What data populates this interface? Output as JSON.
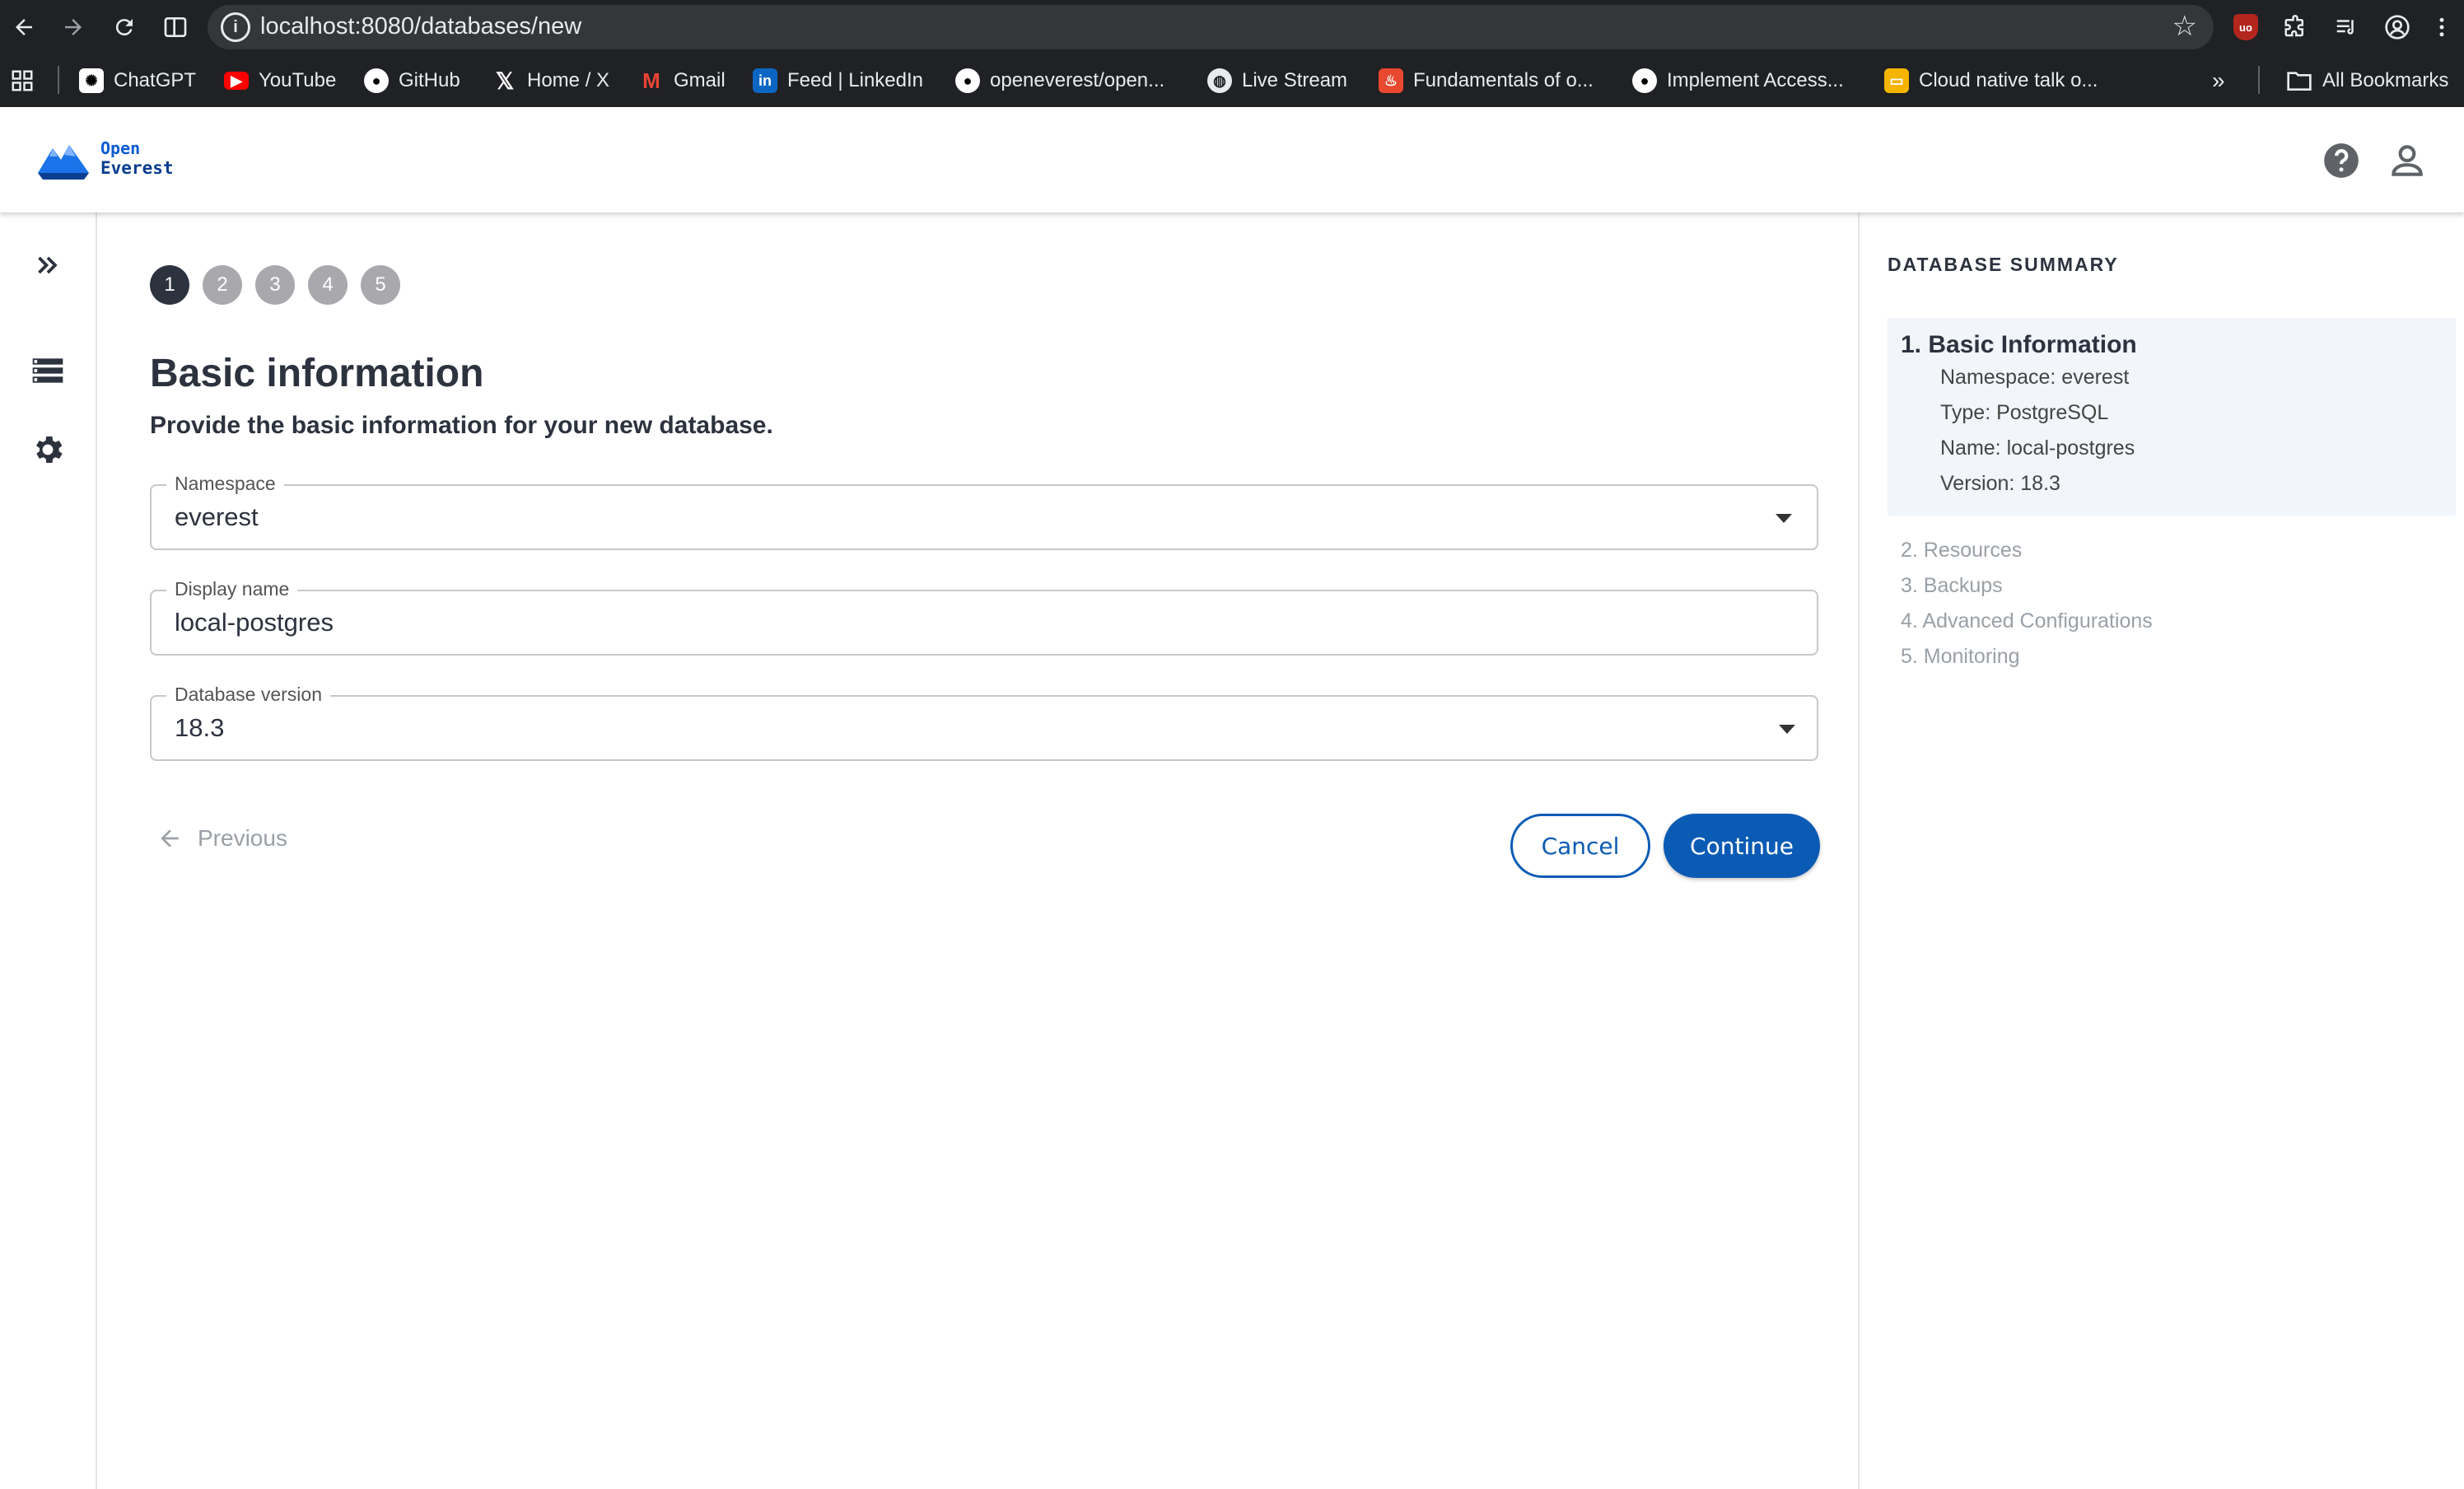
{
  "browser": {
    "url_host": "localhost:8080",
    "url_path": "/databases/new",
    "bookmarks": [
      {
        "label": "ChatGPT",
        "icon": "chatgpt-icon"
      },
      {
        "label": "YouTube",
        "icon": "youtube-icon"
      },
      {
        "label": "GitHub",
        "icon": "github-icon"
      },
      {
        "label": "Home / X",
        "icon": "x-icon"
      },
      {
        "label": "Gmail",
        "icon": "gmail-icon"
      },
      {
        "label": "Feed | LinkedIn",
        "icon": "linkedin-icon"
      },
      {
        "label": "openeverest/open...",
        "icon": "github-icon"
      },
      {
        "label": "Live Stream",
        "icon": "globe-icon"
      },
      {
        "label": "Fundamentals of o...",
        "icon": "flame-icon"
      },
      {
        "label": "Implement Access...",
        "icon": "github-icon"
      },
      {
        "label": "Cloud native talk o...",
        "icon": "slides-icon"
      }
    ],
    "all_bookmarks": "All Bookmarks",
    "ext_badge": "uo"
  },
  "app": {
    "logo_line1": "Open",
    "logo_line2": "Everest",
    "brand_color": "#0b5bb5"
  },
  "wizard": {
    "steps": [
      "1",
      "2",
      "3",
      "4",
      "5"
    ],
    "active_step": 1,
    "title": "Basic information",
    "subtitle": "Provide the basic information for your new database.",
    "fields": {
      "namespace": {
        "label": "Namespace",
        "value": "everest"
      },
      "display_name": {
        "label": "Display name",
        "value": "local-postgres"
      },
      "db_version": {
        "label": "Database version",
        "value": "18.3"
      }
    },
    "previous_label": "Previous",
    "cancel_label": "Cancel",
    "continue_label": "Continue"
  },
  "summary": {
    "title": "DATABASE SUMMARY",
    "section1_title": "1. Basic Information",
    "section1_rows": [
      "Namespace: everest",
      "Type: PostgreSQL",
      "Name: local-postgres",
      "Version: 18.3"
    ],
    "other_steps": [
      "2. Resources",
      "3. Backups",
      "4. Advanced Configurations",
      "5. Monitoring"
    ]
  }
}
